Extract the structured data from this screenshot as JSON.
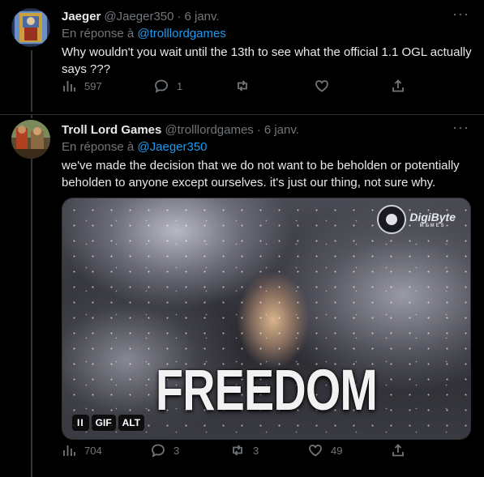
{
  "tweets": [
    {
      "name": "Jaeger",
      "handle": "@Jaeger350",
      "separator": "·",
      "date": "6 janv.",
      "more": "···",
      "reply_prefix": "En réponse à",
      "reply_mention": "@trolllordgames",
      "text": "Why wouldn't you wait until the 13th to see what the official 1.1 OGL actually says ???",
      "stats": {
        "views": "597",
        "replies": "1",
        "retweets": "",
        "likes": ""
      }
    },
    {
      "name": "Troll Lord Games",
      "handle": "@trolllordgames",
      "separator": "·",
      "date": "6 janv.",
      "more": "···",
      "reply_prefix": "En réponse à",
      "reply_mention": "@Jaeger350",
      "text": "we've made the decision that we do not want to be beholden or potentially beholden to anyone except ourselves. it's just our thing, not sure why.",
      "media": {
        "caption": "FREEDOM",
        "watermark_line1": "DigiByte",
        "watermark_line2": "MEMES",
        "badge_pause": "II",
        "badge_gif": "GIF",
        "badge_alt": "ALT"
      },
      "stats": {
        "views": "704",
        "replies": "3",
        "retweets": "3",
        "likes": "49"
      }
    }
  ],
  "icons": [
    "views-icon",
    "reply-icon",
    "retweet-icon",
    "like-icon",
    "share-icon"
  ],
  "colors": {
    "background": "#000000",
    "text": "#e7e9ea",
    "muted": "#71767b",
    "link": "#1d9bf0",
    "border": "#2f3336"
  }
}
